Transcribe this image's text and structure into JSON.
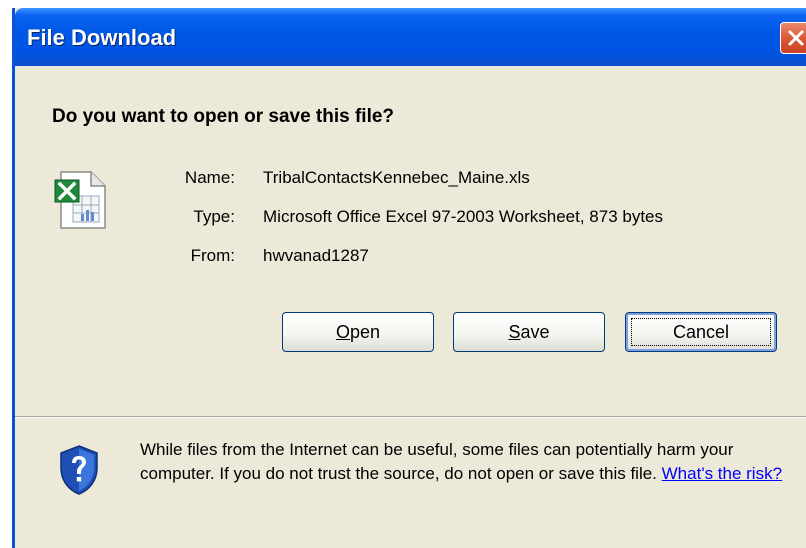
{
  "window": {
    "title": "File Download"
  },
  "dialog": {
    "question": "Do you want to open or save this file?",
    "file_icon": "excel-file-icon",
    "fields": [
      {
        "label": "Name:",
        "value": "TribalContactsKennebec_Maine.xls"
      },
      {
        "label": "Type:",
        "value": "Microsoft Office Excel 97-2003 Worksheet, 873 bytes"
      },
      {
        "label": "From:",
        "value": "hwvanad1287"
      }
    ],
    "buttons": {
      "open": {
        "accel": "O",
        "rest": "pen"
      },
      "save": {
        "accel": "S",
        "rest": "ave"
      },
      "cancel": "Cancel"
    }
  },
  "warning": {
    "icon": "security-shield-question-icon",
    "text": "While files from the Internet can be useful, some files can potentially harm your computer. If you do not trust the source, do not open or save this file. ",
    "link": "What's the risk?"
  },
  "colors": {
    "titlebar": "#0054e3",
    "dialog_bg": "#ece9d8",
    "close": "#d9552f",
    "link": "#0000ff"
  }
}
